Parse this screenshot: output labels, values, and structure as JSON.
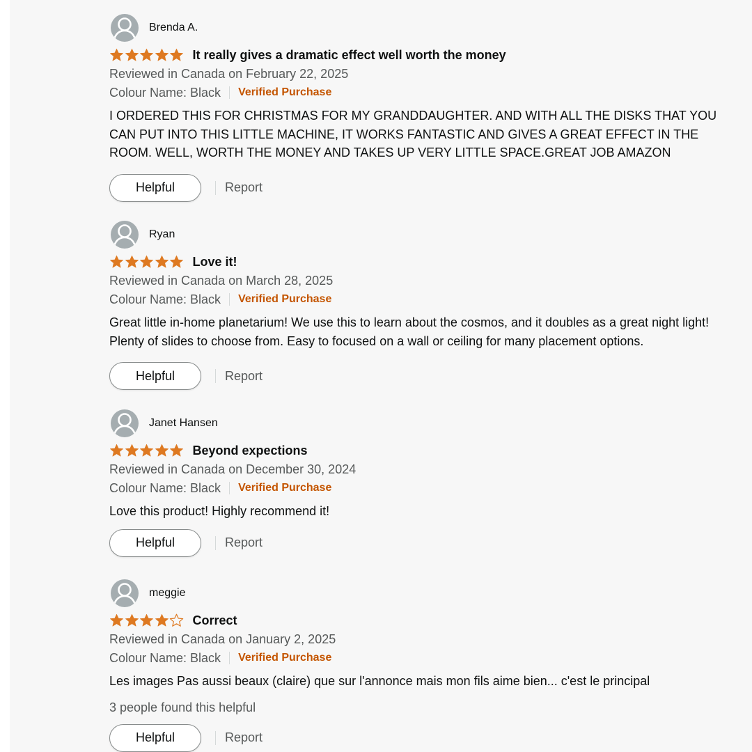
{
  "colors": {
    "star": "#de7921",
    "verified": "#c45500",
    "muted": "#565959",
    "text": "#0f1111"
  },
  "reviews": [
    {
      "name": "Brenda A.",
      "rating": 5,
      "title": "It really gives a dramatic effect well worth the money",
      "meta": "Reviewed in Canada on February 22, 2025",
      "variant": "Colour Name: Black",
      "verified": "Verified Purchase",
      "body": "I ORDERED THIS FOR CHRISTMAS FOR MY GRANDDAUGHTER. AND WITH ALL THE DISKS THAT YOU CAN PUT INTO THIS LITTLE MACHINE, IT WORKS FANTASTIC AND GIVES A GREAT EFFECT IN THE ROOM. WELL, WORTH THE MONEY AND TAKES UP VERY LITTLE SPACE.GREAT JOB AMAZON",
      "helpful_label": "Helpful",
      "report_label": "Report"
    },
    {
      "name": "Ryan",
      "rating": 5,
      "title": "Love it!",
      "meta": "Reviewed in Canada on March 28, 2025",
      "variant": "Colour Name: Black",
      "verified": "Verified Purchase",
      "body": "Great little in-home planetarium! We use this to learn about the cosmos, and it doubles as a great night light! Plenty of slides to choose from. Easy to focused on a wall or ceiling for many placement options.",
      "helpful_label": "Helpful",
      "report_label": "Report"
    },
    {
      "name": "Janet Hansen",
      "rating": 5,
      "title": "Beyond expections",
      "meta": "Reviewed in Canada on December 30, 2024",
      "variant": "Colour Name: Black",
      "verified": "Verified Purchase",
      "body": "Love this product! Highly recommend it!",
      "helpful_label": "Helpful",
      "report_label": "Report"
    },
    {
      "name": "meggie",
      "rating": 4,
      "title": "Correct",
      "meta": "Reviewed in Canada on January 2, 2025",
      "variant": "Colour Name: Black",
      "verified": "Verified Purchase",
      "body": "Les images Pas aussi beaux (claire) que sur l'annonce mais mon fils aime bien... c'est le principal",
      "helpful_count": "3 people found this helpful",
      "helpful_label": "Helpful",
      "report_label": "Report"
    }
  ]
}
